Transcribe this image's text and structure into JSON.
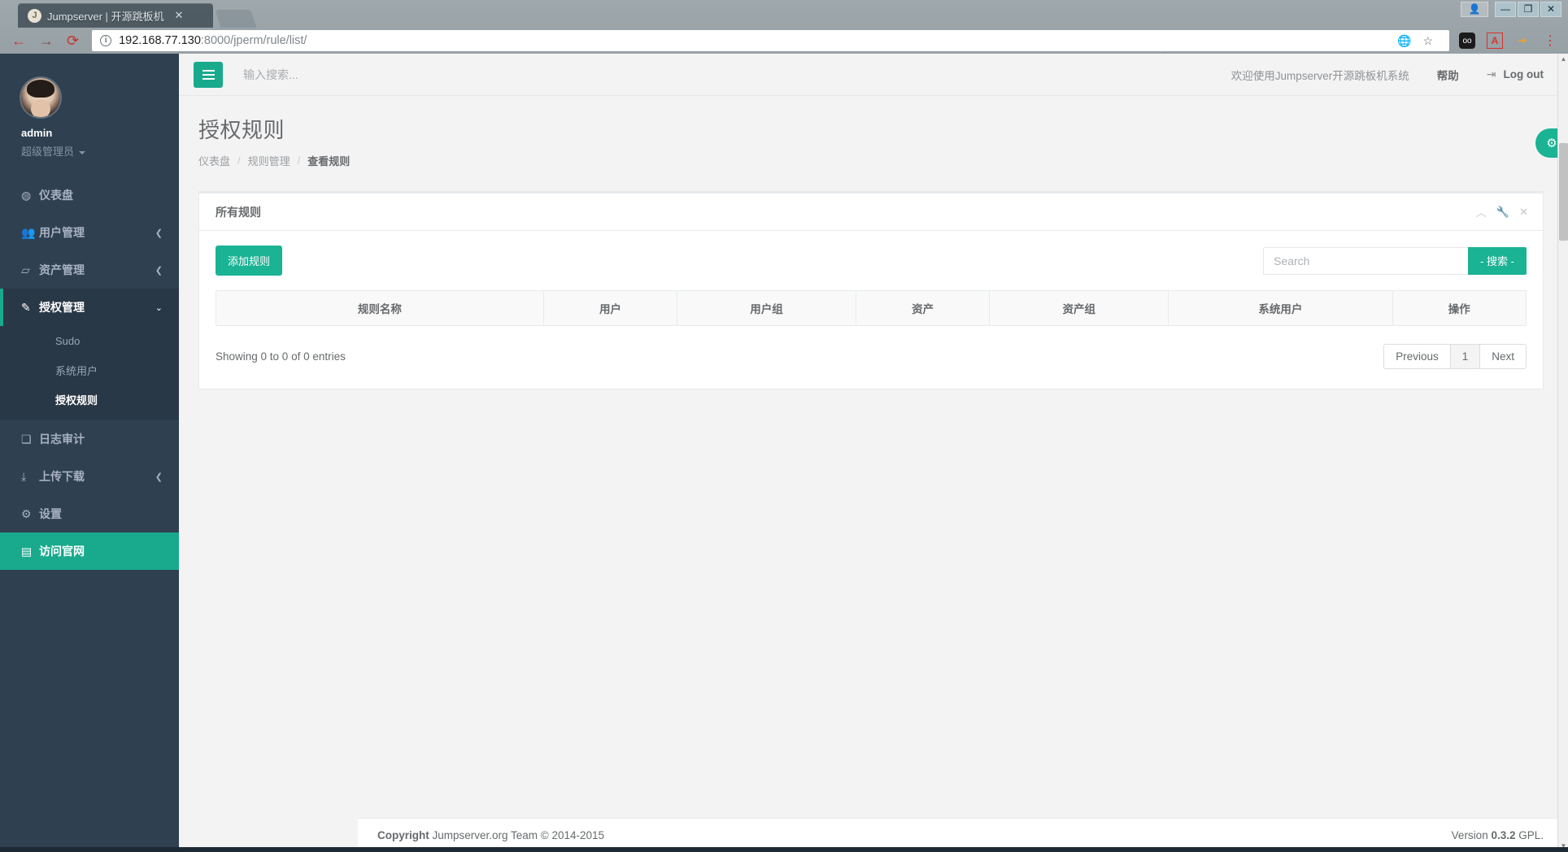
{
  "browser": {
    "tab": {
      "title": "Jumpserver | 开源跳板机",
      "favicon": "jumpserver-favicon",
      "close_label": "✕"
    },
    "new_tab_label": "+",
    "window_controls": {
      "profile": "👤",
      "minimize": "—",
      "restore": "❐",
      "close": "✕"
    },
    "nav": {
      "back": "←",
      "forward": "→",
      "reload": "⟳"
    },
    "url": {
      "host": "192.168.77.130",
      "rest": ":8000/jperm/rule/list/",
      "info_icon": "ⓘ"
    },
    "url_icons": {
      "translate": "translate-icon",
      "bookmark": "☆"
    },
    "extensions": [
      "goo-extension-icon",
      "pdf-extension-icon",
      "arrow-extension-icon",
      "menu-icon"
    ]
  },
  "sidebar": {
    "profile": {
      "name": "admin",
      "role": "超级管理员"
    },
    "items": [
      {
        "label": "仪表盘",
        "icon": "dashboard-icon",
        "state": "normal",
        "chevron": ""
      },
      {
        "label": "用户管理",
        "icon": "users-icon",
        "state": "normal",
        "chevron": "❮"
      },
      {
        "label": "资产管理",
        "icon": "assets-icon",
        "state": "normal",
        "chevron": "❮"
      },
      {
        "label": "授权管理",
        "icon": "permissions-icon",
        "state": "active",
        "chevron": "⌄"
      },
      {
        "label": "日志审计",
        "icon": "audit-icon",
        "state": "normal",
        "chevron": ""
      },
      {
        "label": "上传下载",
        "icon": "upload-download-icon",
        "state": "normal",
        "chevron": "❮"
      },
      {
        "label": "设置",
        "icon": "settings-icon",
        "state": "normal",
        "chevron": ""
      },
      {
        "label": "访问官网",
        "icon": "website-icon",
        "state": "highlight",
        "chevron": ""
      }
    ],
    "subitems": [
      {
        "label": "Sudo",
        "current": false
      },
      {
        "label": "系统用户",
        "current": false
      },
      {
        "label": "授权规则",
        "current": true
      }
    ]
  },
  "topnav": {
    "menu_toggle": "hamburger-icon",
    "search_placeholder": "输入搜索...",
    "search_value": "",
    "welcome": "欢迎使用Jumpserver开源跳板机系统",
    "help": "帮助",
    "logout": "Log out",
    "logout_icon": "logout-icon"
  },
  "page": {
    "title": "授权规则",
    "breadcrumb": [
      {
        "label": "仪表盘",
        "current": false
      },
      {
        "label": "规则管理",
        "current": false
      },
      {
        "label": "查看规则",
        "current": true
      }
    ],
    "breadcrumb_sep": "/"
  },
  "panel": {
    "title": "所有规则",
    "tools": [
      {
        "icon": "chevron-up-icon",
        "glyph": "︿"
      },
      {
        "icon": "wrench-icon",
        "glyph": "🔧"
      },
      {
        "icon": "close-icon",
        "glyph": "✕"
      }
    ],
    "add_button": "添加规则",
    "search_placeholder": "Search",
    "search_value": "",
    "search_button": "- 搜索 -",
    "columns": [
      "规则名称",
      "用户",
      "用户组",
      "资产",
      "资产组",
      "系统用户",
      "操作"
    ],
    "rows": [],
    "entries_info": "Showing 0 to 0 of 0 entries",
    "pagination": {
      "previous": "Previous",
      "pages": [
        "1"
      ],
      "next": "Next",
      "active_page": "1"
    }
  },
  "fab": {
    "icon": "gears-icon",
    "glyph": "⚙"
  },
  "footer": {
    "copyright_bold": "Copyright",
    "copyright_text": " Jumpserver.org Team © 2014-2015",
    "version_prefix": "Version ",
    "version_number": "0.3.2",
    "version_suffix": " GPL."
  }
}
